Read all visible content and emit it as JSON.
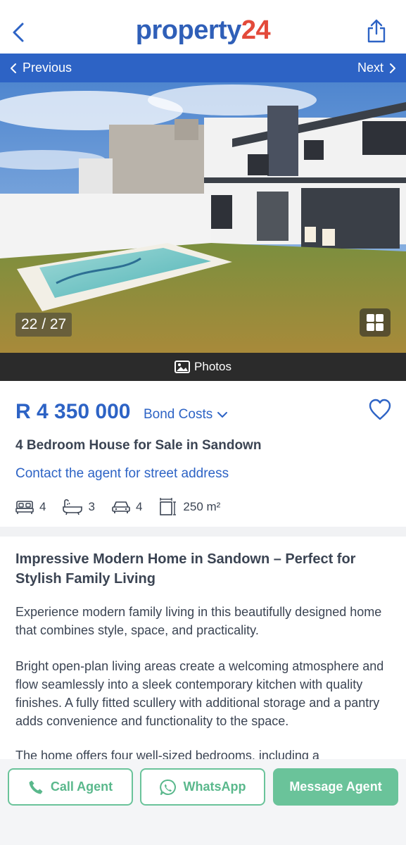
{
  "header": {
    "logo_main": "property",
    "logo_num": "24"
  },
  "nav": {
    "previous_label": "Previous",
    "next_label": "Next"
  },
  "gallery": {
    "counter": "22 / 27",
    "photos_label": "Photos"
  },
  "listing": {
    "price": "R 4 350 000",
    "bond_costs_label": "Bond Costs",
    "title": "4 Bedroom House for Sale in Sandown",
    "contact_link": "Contact the agent for street address",
    "features": {
      "bedrooms": "4",
      "bathrooms": "3",
      "garages": "4",
      "floor_size": "250 m²"
    }
  },
  "description": {
    "heading": "Impressive Modern Home in Sandown – Perfect for Stylish Family Living",
    "paragraphs": [
      "Experience modern family living in this beautifully designed home that combines style, space, and practicality.",
      "Bright open-plan living areas create a welcoming atmosphere and flow seamlessly into a sleek contemporary kitchen with quality finishes. A fully fitted scullery with additional storage and a pantry adds convenience and functionality to the space.",
      "The home offers four well-sized bedrooms, including a"
    ]
  },
  "actions": {
    "call_label": "Call Agent",
    "whatsapp_label": "WhatsApp",
    "message_label": "Message Agent"
  },
  "colors": {
    "brand_blue": "#2d63c5",
    "brand_red": "#e34a3a",
    "action_green": "#6ac39a"
  }
}
